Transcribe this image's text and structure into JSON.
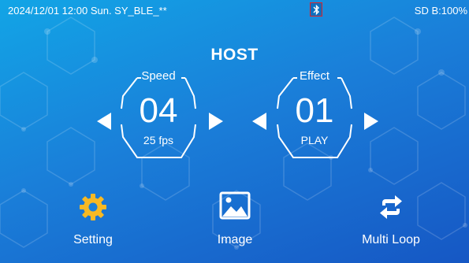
{
  "statusbar": {
    "left_text": "2024/12/01 12:00 Sun. SY_BLE_**",
    "right_text": "SD B:100%"
  },
  "main": {
    "title": "HOST",
    "speed": {
      "label": "Speed",
      "value": "04",
      "sub": "25 fps"
    },
    "effect": {
      "label": "Effect",
      "value": "01",
      "sub": "PLAY"
    }
  },
  "nav": {
    "setting_label": "Setting",
    "image_label": "Image",
    "multiloop_label": "Multi Loop"
  },
  "icons": {
    "bluetooth": "bluetooth-icon",
    "setting": "gear-icon",
    "image": "image-icon",
    "multiloop": "repeat-icon",
    "prev": "left-arrow-icon",
    "next": "right-arrow-icon"
  },
  "colors": {
    "bg_top": "#12a5e6",
    "bg_bottom": "#1657c4",
    "accent": "#f7b923",
    "bt_border": "#d8262b"
  }
}
